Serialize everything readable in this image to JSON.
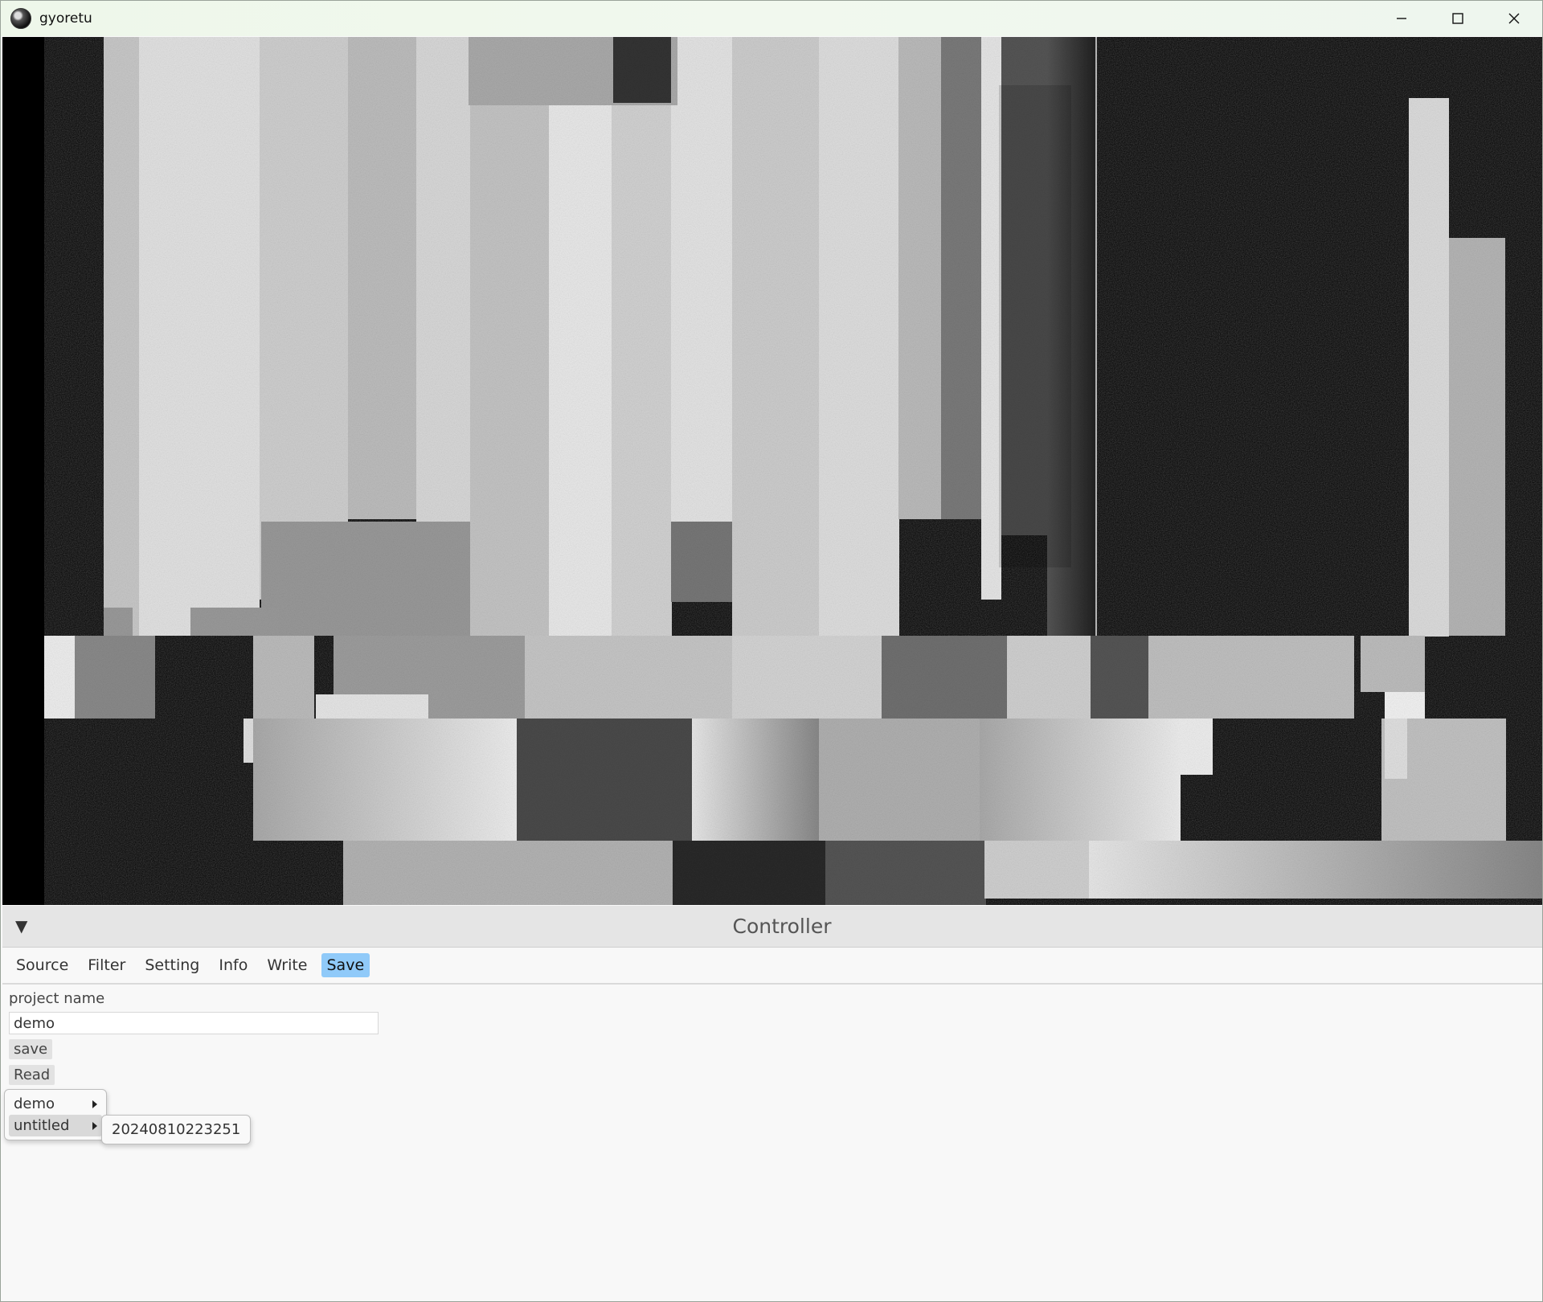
{
  "window": {
    "title": "gyoretu",
    "controls": [
      "minimize-icon",
      "maximize-icon",
      "close-icon"
    ]
  },
  "controller": {
    "toggle": "▼",
    "title": "Controller",
    "tabs": [
      {
        "label": "Source",
        "active": false
      },
      {
        "label": "Filter",
        "active": false
      },
      {
        "label": "Setting",
        "active": false
      },
      {
        "label": "Info",
        "active": false
      },
      {
        "label": "Write",
        "active": false
      },
      {
        "label": "Save",
        "active": true
      }
    ],
    "project_name_label": "project name",
    "project_name_value": "demo",
    "save_button": "save",
    "read_button": "Read",
    "read_menu": {
      "items": [
        "demo",
        "untitled"
      ],
      "hovered": "untitled",
      "submenu_items": [
        "20240810223251"
      ]
    }
  },
  "colors": {
    "tab_active": "#90caf9",
    "canvas_background": "#000000"
  }
}
